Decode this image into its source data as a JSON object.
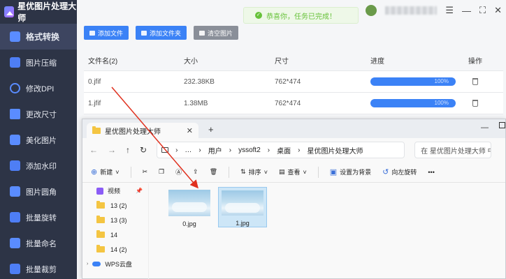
{
  "app": {
    "title": "星优图片处理大师"
  },
  "sidebar": {
    "items": [
      {
        "label": "格式转换",
        "active": true
      },
      {
        "label": "图片压缩"
      },
      {
        "label": "修改DPI"
      },
      {
        "label": "更改尺寸"
      },
      {
        "label": "美化图片"
      },
      {
        "label": "添加水印"
      },
      {
        "label": "图片圆角"
      },
      {
        "label": "批量旋转"
      },
      {
        "label": "批量命名"
      },
      {
        "label": "批量裁剪"
      }
    ]
  },
  "toolbar": {
    "add_file": "添加文件",
    "add_folder": "添加文件夹",
    "clear": "清空图片"
  },
  "toast": {
    "message": "恭喜你，任务已完成！"
  },
  "table": {
    "headers": {
      "name": "文件名(2)",
      "size": "大小",
      "dim": "尺寸",
      "progress": "进度",
      "op": "操作"
    },
    "rows": [
      {
        "name": "0.jfif",
        "size": "232.38KB",
        "dim": "762*474",
        "progress": "100%"
      },
      {
        "name": "1.jfif",
        "size": "1.38MB",
        "dim": "762*474",
        "progress": "100%"
      }
    ]
  },
  "explorer": {
    "tab_title": "星优图片处理大师",
    "breadcrumb": [
      "用户",
      "yssoft2",
      "桌面",
      "星优图片处理大师"
    ],
    "search_placeholder": "在 星优图片处理大师 中",
    "commands": {
      "new": "新建",
      "sort": "排序",
      "view": "查看",
      "set_bg": "设置为背景",
      "rotate_right": "向左旋转"
    },
    "tree": [
      {
        "label": "视频"
      },
      {
        "label": "13 (2)"
      },
      {
        "label": "13 (3)"
      },
      {
        "label": "14"
      },
      {
        "label": "14 (2)"
      },
      {
        "label": "WPS云盘"
      }
    ],
    "files": [
      {
        "name": "0.jpg"
      },
      {
        "name": "1.jpg"
      }
    ]
  },
  "colors": {
    "sidebar_bg": "#2d3446",
    "accent": "#3b82f6",
    "success": "#67c23a"
  }
}
